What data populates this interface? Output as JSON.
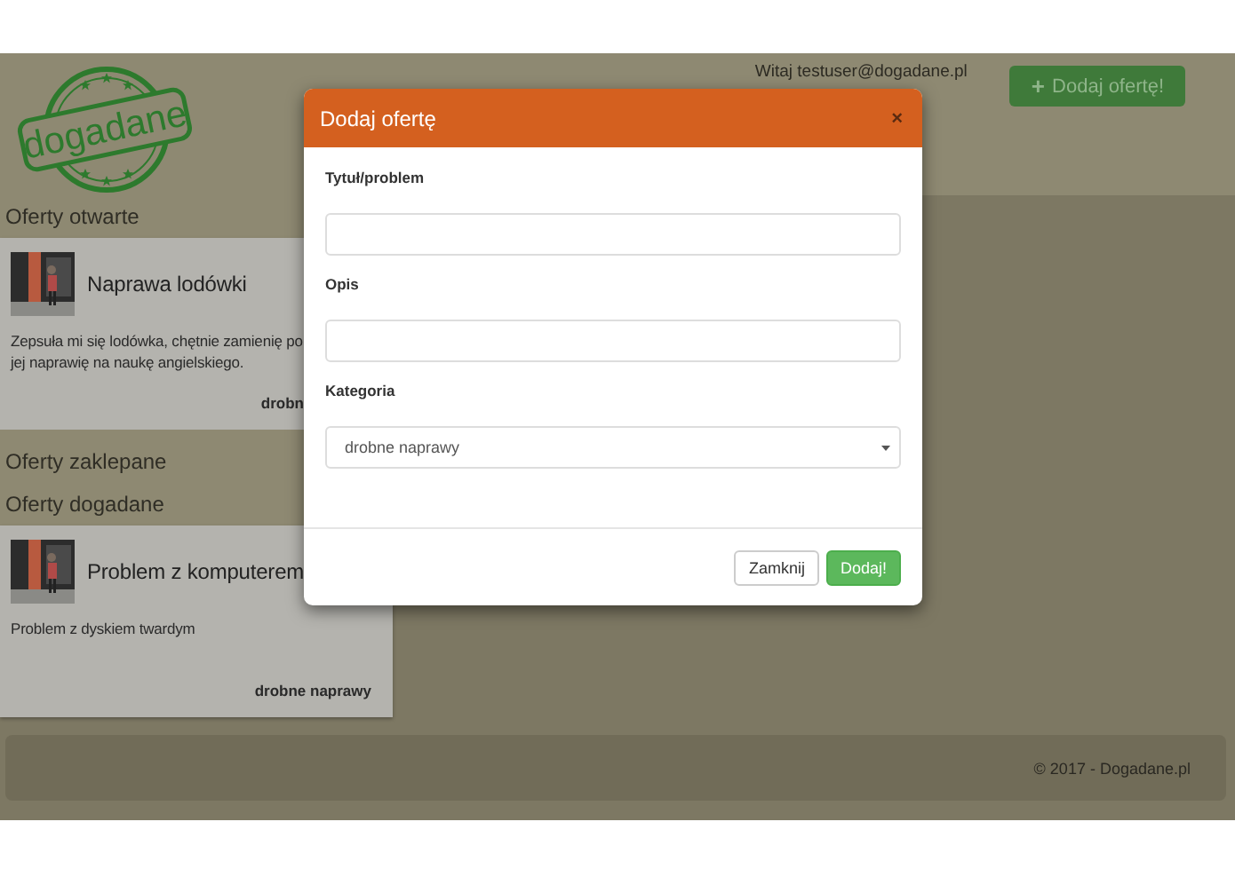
{
  "header": {
    "logo": "dogadane",
    "greeting": "Witaj testuser@dogadane.pl",
    "add_button": {
      "icon": "+",
      "label": "Dodaj ofertę!"
    }
  },
  "sections": [
    {
      "title": "Oferty otwarte",
      "offers": [
        {
          "title": "Naprawa lodówki",
          "description_lines": [
            "Zepsuła mi się lodówka, chętnie zamienię po",
            "jej naprawię na naukę angielskiego."
          ],
          "category": "drobn"
        }
      ]
    },
    {
      "title": "Oferty zaklepane"
    },
    {
      "title": "Oferty dogadane",
      "offers": [
        {
          "title": "Problem z komputerem",
          "description_lines": [
            "Problem z dyskiem twardym"
          ],
          "category": "drobne naprawy"
        }
      ]
    }
  ],
  "modal": {
    "title": "Dodaj ofertę",
    "close": "×",
    "fields": [
      {
        "kind": "text",
        "label": "Tytuł/problem"
      },
      {
        "kind": "text",
        "label": "Opis"
      },
      {
        "kind": "select",
        "label": "Kategoria",
        "value": "drobne naprawy"
      }
    ],
    "buttons": [
      {
        "kind": "secondary",
        "label": "Zamknij"
      },
      {
        "kind": "primary",
        "label": "Dodaj!"
      }
    ]
  },
  "footer": "© 2017 - Dogadane.pl"
}
